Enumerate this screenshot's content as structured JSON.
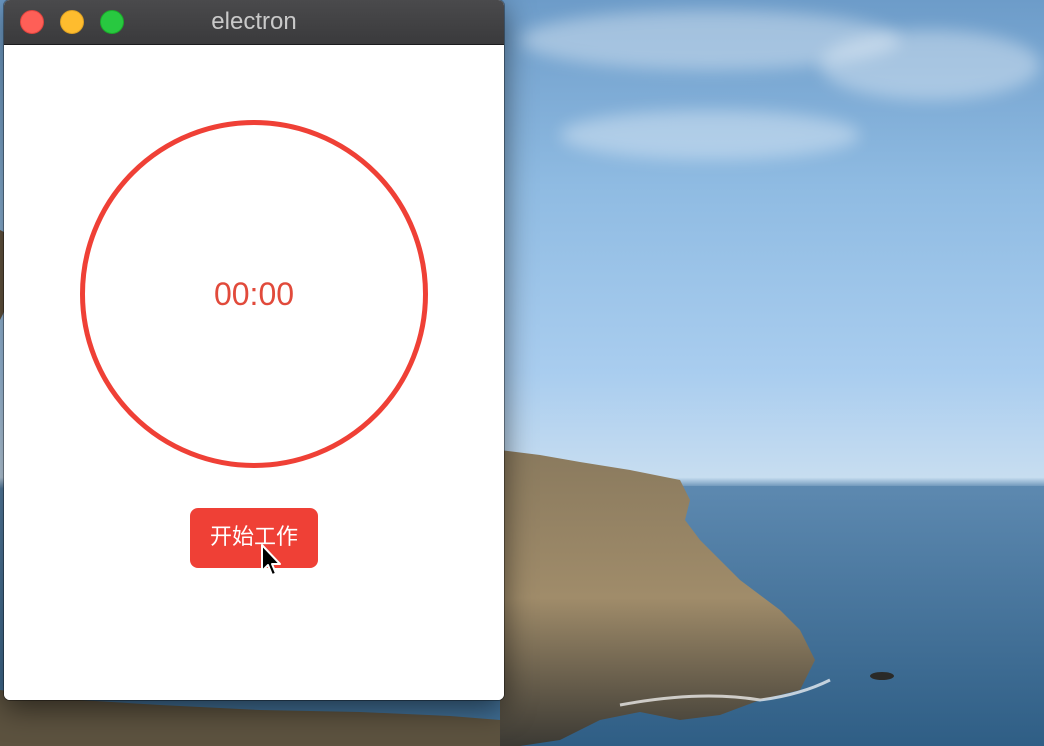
{
  "window": {
    "title": "electron"
  },
  "timer": {
    "display": "00:00"
  },
  "controls": {
    "start_label": "开始工作"
  },
  "colors": {
    "accent": "#ef4036",
    "timer_text": "#e14a3b",
    "titlebar": "#3a3a3c",
    "close": "#fe5f57",
    "minimize": "#febc2e",
    "maximize": "#28c840"
  }
}
